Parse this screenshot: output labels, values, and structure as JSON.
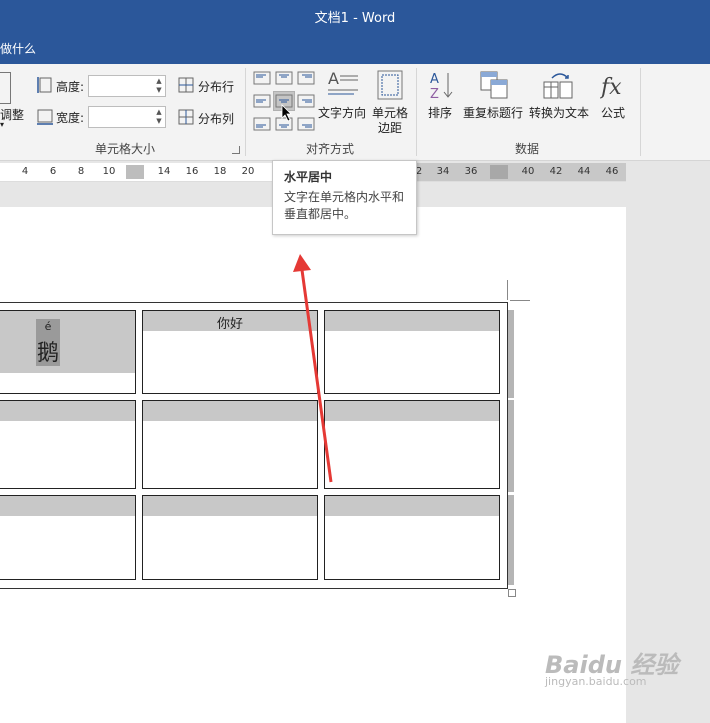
{
  "titlebar": {
    "title": "文档1  -  Word"
  },
  "tellme": {
    "text": "做什么"
  },
  "cell_size": {
    "autofit_label": "调整",
    "height_label": "高度:",
    "width_label": "宽度:",
    "distribute_rows": "分布行",
    "distribute_cols": "分布列",
    "group_label": "单元格大小"
  },
  "alignment": {
    "text_direction": "文字方向",
    "cell_margins_line1": "单元格",
    "cell_margins_line2": "边距",
    "group_label": "对齐方式"
  },
  "data_group": {
    "sort": "排序",
    "repeat_header": "重复标题行",
    "convert_to_text": "转换为文本",
    "formula": "公式",
    "group_label": "数据"
  },
  "ruler": {
    "ticks_left": [
      "4",
      "6",
      "8",
      "10"
    ],
    "ticks_mid": [
      "14",
      "16",
      "18",
      "20"
    ],
    "ticks_right": [
      "2",
      "34",
      "36"
    ],
    "ticks_far": [
      "40",
      "42",
      "44",
      "46"
    ]
  },
  "tooltip": {
    "title": "水平居中",
    "description": "文字在单元格内水平和垂直都居中。"
  },
  "table": {
    "cell_1_pinyin": "é",
    "cell_1_char": "鹅",
    "cell_2_text": "你好"
  },
  "watermark": {
    "line1": "Baidu 经验",
    "line2": "jingyan.baidu.com"
  },
  "colors": {
    "accent": "#2b579a",
    "arrow": "#e53935"
  }
}
